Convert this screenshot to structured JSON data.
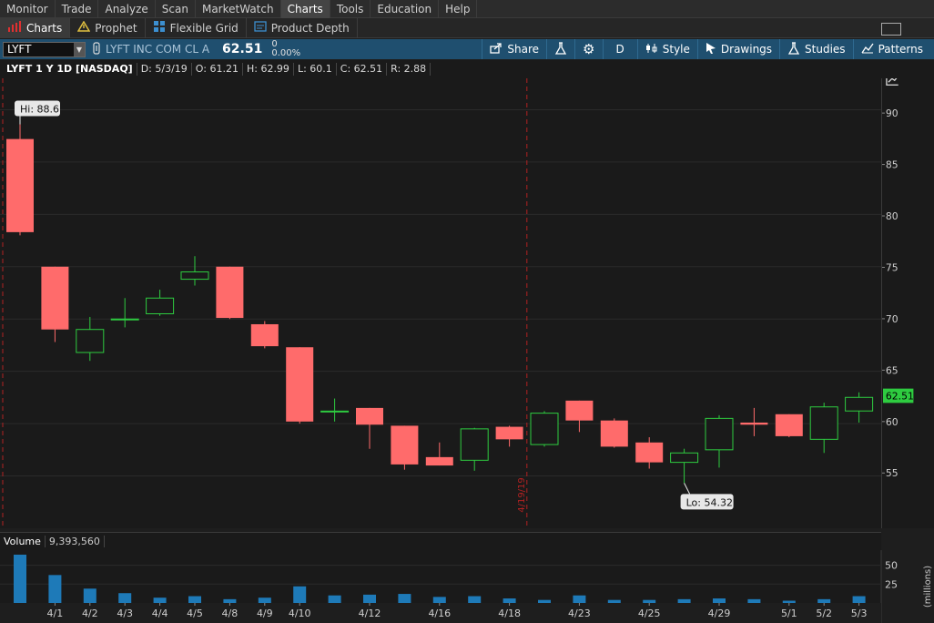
{
  "menubar": {
    "items": [
      "Monitor",
      "Trade",
      "Analyze",
      "Scan",
      "MarketWatch",
      "Charts",
      "Tools",
      "Education",
      "Help"
    ],
    "active": "Charts"
  },
  "subbar": {
    "items": [
      {
        "label": "Charts",
        "icon": "bar-chart-icon"
      },
      {
        "label": "Prophet",
        "icon": "warning-triangle-icon"
      },
      {
        "label": "Flexible Grid",
        "icon": "grid-icon"
      },
      {
        "label": "Product Depth",
        "icon": "depth-icon"
      }
    ],
    "active": "Charts"
  },
  "toolbar": {
    "symbol": "LYFT",
    "company": "LYFT INC COM CL A",
    "last": "62.51",
    "change": "0",
    "change_pct": "0.00%",
    "buttons": {
      "share": "Share",
      "aggregation": "D",
      "style": "Style",
      "drawings": "Drawings",
      "studies": "Studies",
      "patterns": "Patterns"
    }
  },
  "infobar": {
    "title": "LYFT 1 Y 1D [NASDAQ]",
    "date": "D: 5/3/19",
    "open": "O: 61.21",
    "high": "H: 62.99",
    "low": "L: 60.1",
    "close": "C: 62.51",
    "range": "R: 2.88"
  },
  "colors": {
    "up": "#2ecc40",
    "down": "#ff6b6b",
    "volume": "#1e7ab8",
    "accent_bar": "#1f4f6f",
    "price_marker": "#2ecc40",
    "event_line": "#b22222"
  },
  "chart_data": {
    "type": "candlestick",
    "ylim": [
      50,
      93
    ],
    "y_ticks": [
      55,
      60,
      65,
      70,
      75,
      80,
      85,
      90
    ],
    "candles": [
      {
        "date": "3/29",
        "o": 87.2,
        "h": 88.6,
        "l": 78.0,
        "c": 78.3
      },
      {
        "date": "4/1",
        "o": 75.0,
        "h": 75.0,
        "l": 67.8,
        "c": 69.0
      },
      {
        "date": "4/2",
        "o": 66.8,
        "h": 70.2,
        "l": 66.0,
        "c": 69.0
      },
      {
        "date": "4/3",
        "o": 70.0,
        "h": 72.0,
        "l": 69.2,
        "c": 70.0
      },
      {
        "date": "4/4",
        "o": 70.5,
        "h": 72.8,
        "l": 70.3,
        "c": 72.0
      },
      {
        "date": "4/5",
        "o": 73.8,
        "h": 76.0,
        "l": 73.2,
        "c": 74.5
      },
      {
        "date": "4/8",
        "o": 75.0,
        "h": 75.0,
        "l": 70.0,
        "c": 70.1
      },
      {
        "date": "4/9",
        "o": 69.5,
        "h": 69.8,
        "l": 67.2,
        "c": 67.4
      },
      {
        "date": "4/10",
        "o": 67.3,
        "h": 67.3,
        "l": 60.0,
        "c": 60.2
      },
      {
        "date": "4/11",
        "o": 61.2,
        "h": 62.4,
        "l": 60.2,
        "c": 61.2
      },
      {
        "date": "4/12",
        "o": 61.5,
        "h": 61.5,
        "l": 57.6,
        "c": 59.9
      },
      {
        "date": "4/15",
        "o": 59.8,
        "h": 59.8,
        "l": 55.6,
        "c": 56.1
      },
      {
        "date": "4/16",
        "o": 56.8,
        "h": 58.2,
        "l": 56.0,
        "c": 56.0
      },
      {
        "date": "4/17",
        "o": 56.5,
        "h": 59.6,
        "l": 55.5,
        "c": 59.5
      },
      {
        "date": "4/18",
        "o": 59.7,
        "h": 59.8,
        "l": 57.8,
        "c": 58.5
      },
      {
        "date": "4/22",
        "o": 58.0,
        "h": 61.2,
        "l": 57.8,
        "c": 61.0
      },
      {
        "date": "4/23",
        "o": 62.2,
        "h": 62.2,
        "l": 59.2,
        "c": 60.3
      },
      {
        "date": "4/24",
        "o": 60.3,
        "h": 60.5,
        "l": 57.7,
        "c": 57.8
      },
      {
        "date": "4/25",
        "o": 58.2,
        "h": 58.7,
        "l": 55.7,
        "c": 56.3
      },
      {
        "date": "4/26",
        "o": 56.3,
        "h": 57.6,
        "l": 54.32,
        "c": 57.2
      },
      {
        "date": "4/29",
        "o": 57.5,
        "h": 60.8,
        "l": 55.8,
        "c": 60.5
      },
      {
        "date": "4/30",
        "o": 60.1,
        "h": 61.5,
        "l": 58.8,
        "c": 59.9
      },
      {
        "date": "5/1",
        "o": 60.9,
        "h": 60.9,
        "l": 58.7,
        "c": 58.8
      },
      {
        "date": "5/2",
        "o": 58.5,
        "h": 62.0,
        "l": 57.2,
        "c": 61.6
      },
      {
        "date": "5/3",
        "o": 61.21,
        "h": 62.99,
        "l": 60.1,
        "c": 62.51
      }
    ],
    "volume_millions": [
      64,
      37,
      19,
      13,
      7,
      9,
      5,
      7,
      22,
      10,
      11,
      12,
      8,
      9,
      6,
      4,
      10,
      4,
      4,
      5,
      6,
      5,
      3,
      5,
      9
    ],
    "volume_ticks": [
      25,
      50
    ],
    "volume_label": "Volume",
    "volume_value": "9,393,560",
    "volume_unit": "(millions)",
    "x_labels": [
      "4/1",
      "4/2",
      "4/3",
      "4/4",
      "4/5",
      "4/8",
      "4/9",
      "4/10",
      "4/12",
      "4/16",
      "4/18",
      "4/23",
      "4/25",
      "4/29",
      "5/1",
      "5/2",
      "5/3"
    ],
    "annotations": {
      "high": "Hi: 88.6",
      "low": "Lo: 54.32",
      "event": "4/19/19",
      "last_price": "62.51"
    }
  }
}
